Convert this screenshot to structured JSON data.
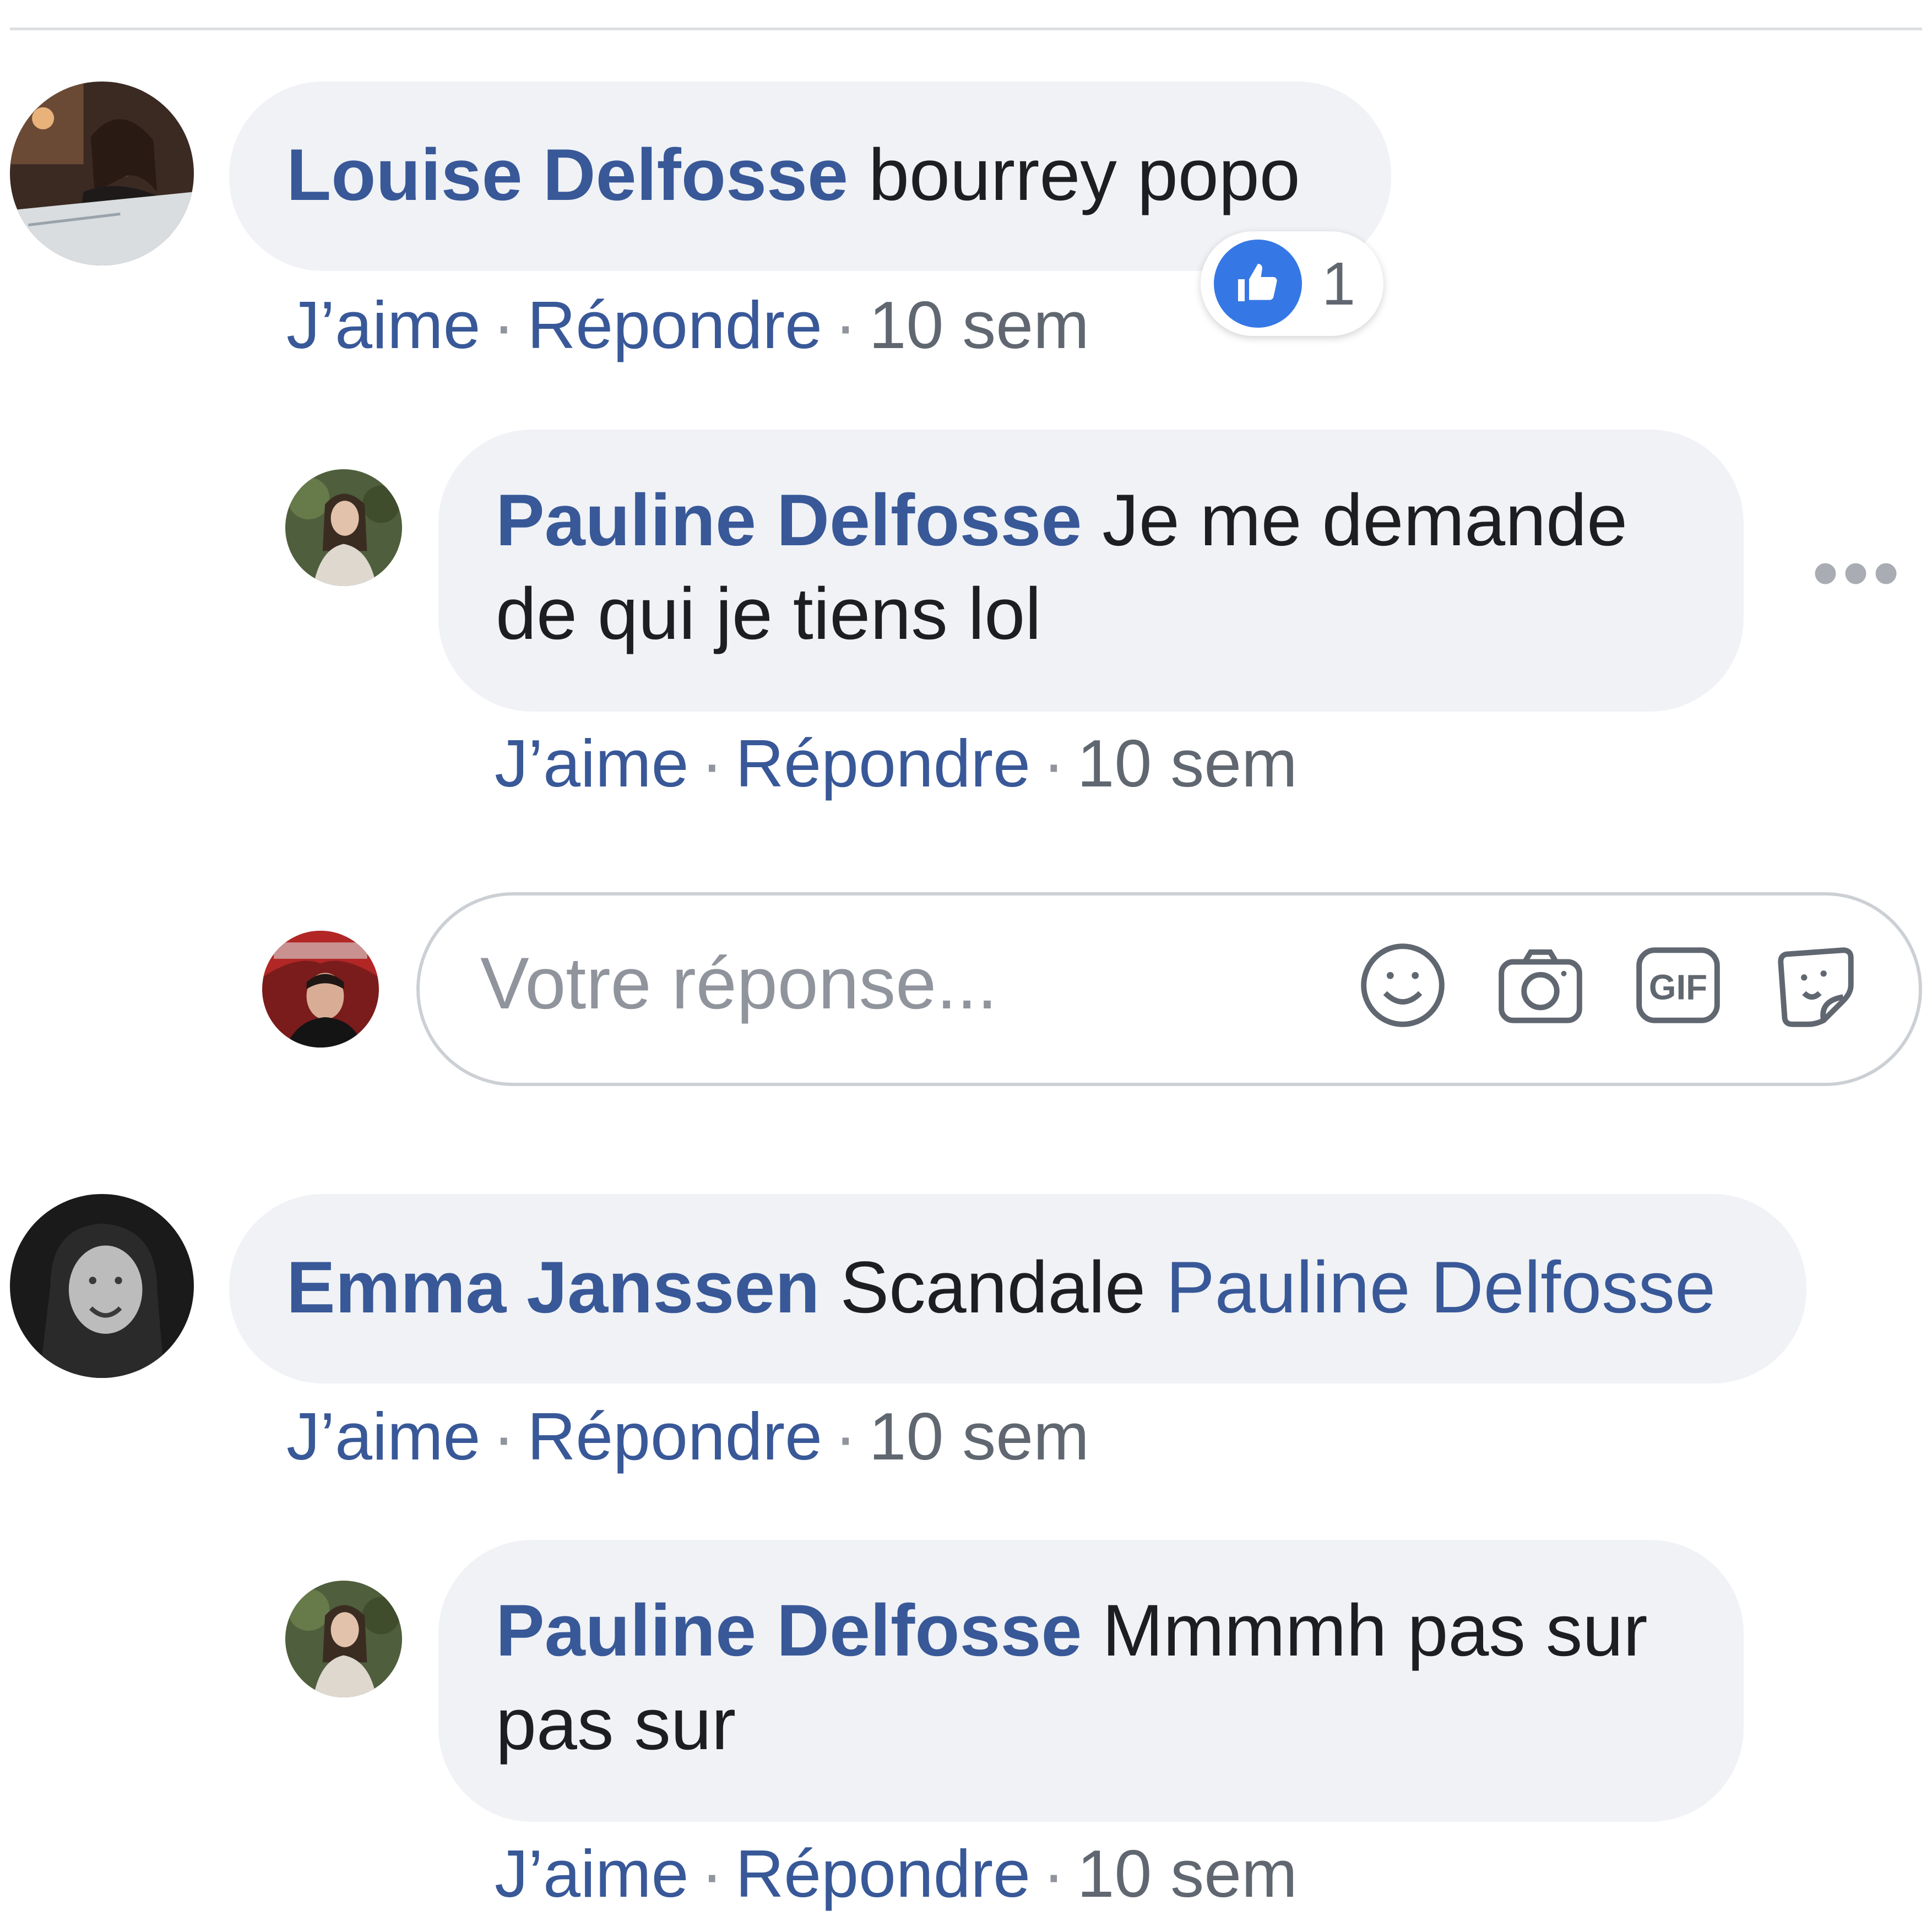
{
  "actions": {
    "like_label": "J’aime",
    "reply_label": "Répondre",
    "separator": "·"
  },
  "comments": [
    {
      "author": "Louise Delfosse",
      "text": "bourrey popo",
      "time": "10 sem",
      "reaction": {
        "icon": "like-icon",
        "count": "1"
      }
    },
    {
      "author": "Pauline Delfosse",
      "text": "Je me demande",
      "text_line2": "de qui je tiens lol",
      "time": "10 sem"
    },
    {
      "author": "Emma Janssen",
      "text": "Scandale",
      "mention": "Pauline Delfosse",
      "time": "10 sem"
    },
    {
      "author": "Pauline Delfosse",
      "text": "Mmmmh pas sur",
      "text_line2": "pas sur",
      "time": "10 sem"
    }
  ],
  "reply_box": {
    "placeholder": "Votre réponse...",
    "tools": [
      "emoji-icon",
      "camera-icon",
      "gif-icon",
      "sticker-icon"
    ],
    "gif_label": "GIF"
  },
  "colors": {
    "link": "#385898",
    "bubble": "#f0f2f5",
    "like": "#3578e5",
    "meta": "#606770"
  }
}
